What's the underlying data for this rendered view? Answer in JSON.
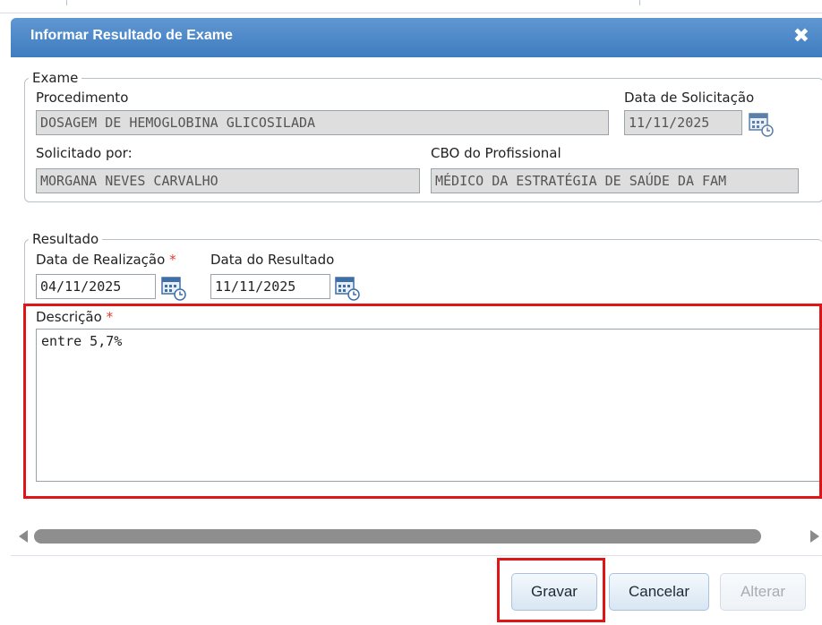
{
  "dialog": {
    "title": "Informar Resultado de Exame",
    "close_symbol": "✖"
  },
  "exame": {
    "legend": "Exame",
    "procedimento_label": "Procedimento",
    "procedimento_value": "DOSAGEM DE HEMOGLOBINA GLICOSILADA",
    "data_solicitacao_label": "Data de Solicitação",
    "data_solicitacao_value": "11/11/2025",
    "solicitado_por_label": "Solicitado por:",
    "solicitado_por_value": "MORGANA NEVES CARVALHO",
    "cbo_label": "CBO do Profissional",
    "cbo_value": "MÉDICO DA ESTRATÉGIA DE SAÚDE DA FAM"
  },
  "resultado": {
    "legend": "Resultado",
    "data_realizacao_label": "Data de Realização",
    "data_realizacao_value": "04/11/2025",
    "data_resultado_label": "Data do Resultado",
    "data_resultado_value": "11/11/2025",
    "descricao_label": "Descrição",
    "descricao_value": "entre 5,7%",
    "required_mark": "*"
  },
  "buttons": {
    "gravar": "Gravar",
    "cancelar": "Cancelar",
    "alterar": "Alterar"
  },
  "icons": {
    "calendar": "calendar-clock-icon",
    "close": "close-icon"
  },
  "colors": {
    "titlebar": "#4a87c7",
    "highlight": "#e01515",
    "required": "#e23b2e"
  }
}
